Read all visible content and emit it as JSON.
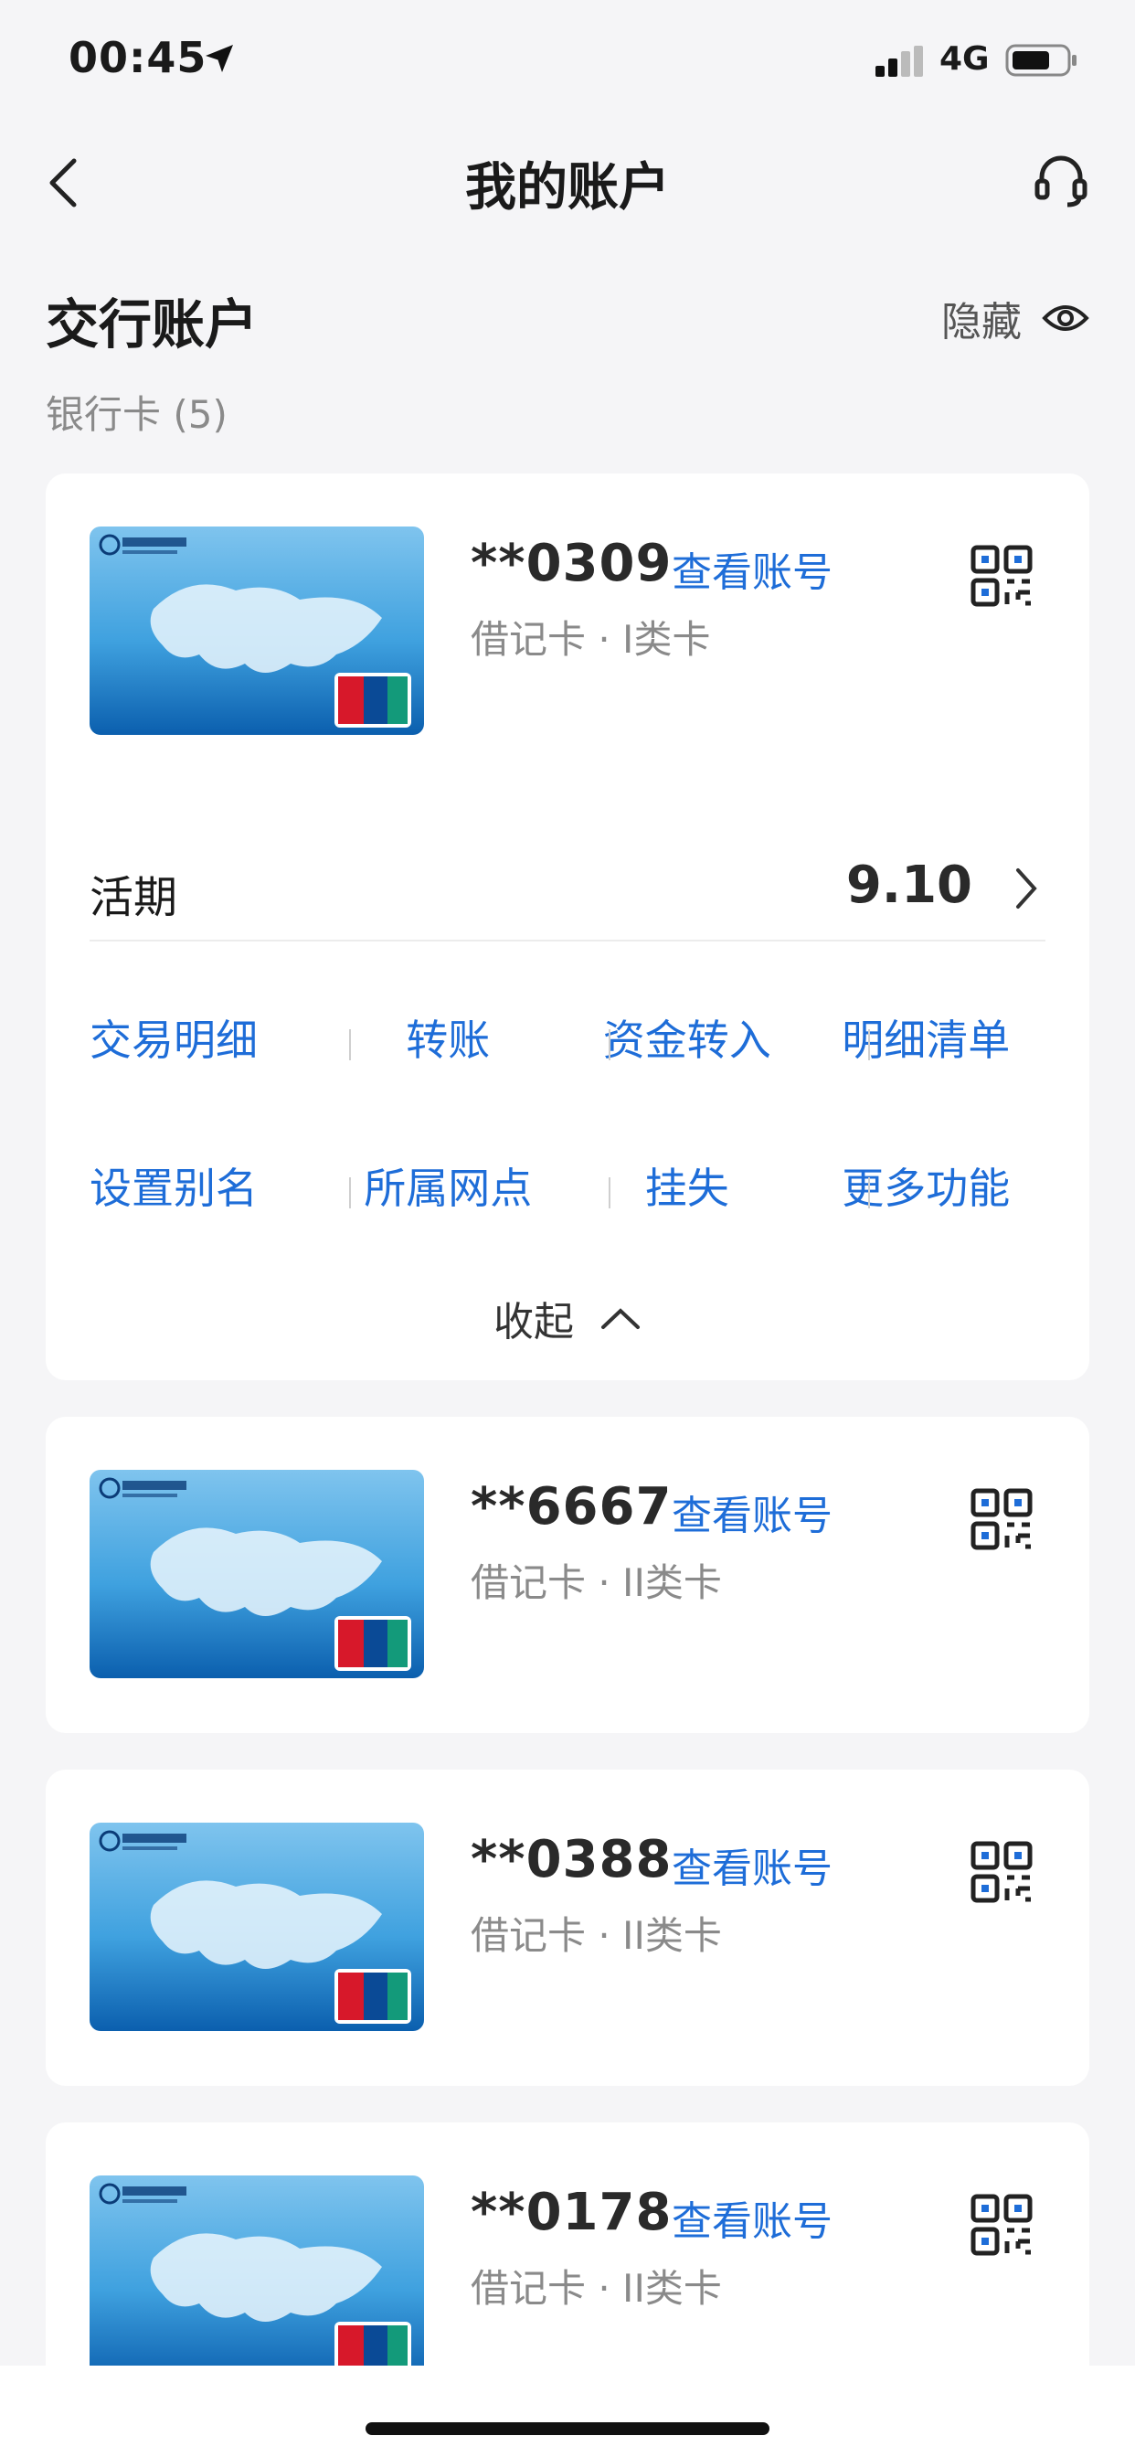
{
  "status_bar": {
    "time": "00:45",
    "network": "4G"
  },
  "nav": {
    "title": "我的账户"
  },
  "section": {
    "title": "交行账户",
    "hide_label": "隐藏",
    "count_label": "银行卡 (5)"
  },
  "view_account_label": "查看账号",
  "cards": [
    {
      "number": "**0309",
      "type": "借记卡 · I类卡"
    },
    {
      "number": "**6667",
      "type": "借记卡 · II类卡"
    },
    {
      "number": "**0388",
      "type": "借记卡 · II类卡"
    },
    {
      "number": "**0178",
      "type": "借记卡 · II类卡"
    }
  ],
  "balance": {
    "label": "活期",
    "value": "9.10"
  },
  "actions_row1": [
    "交易明细",
    "转账",
    "资金转入",
    "明细清单"
  ],
  "actions_row2": [
    "设置别名",
    "所属网点",
    "挂失",
    "更多功能"
  ],
  "collapse_label": "收起",
  "colors": {
    "accent": "#1e6dd8",
    "background": "#f5f5f7"
  }
}
